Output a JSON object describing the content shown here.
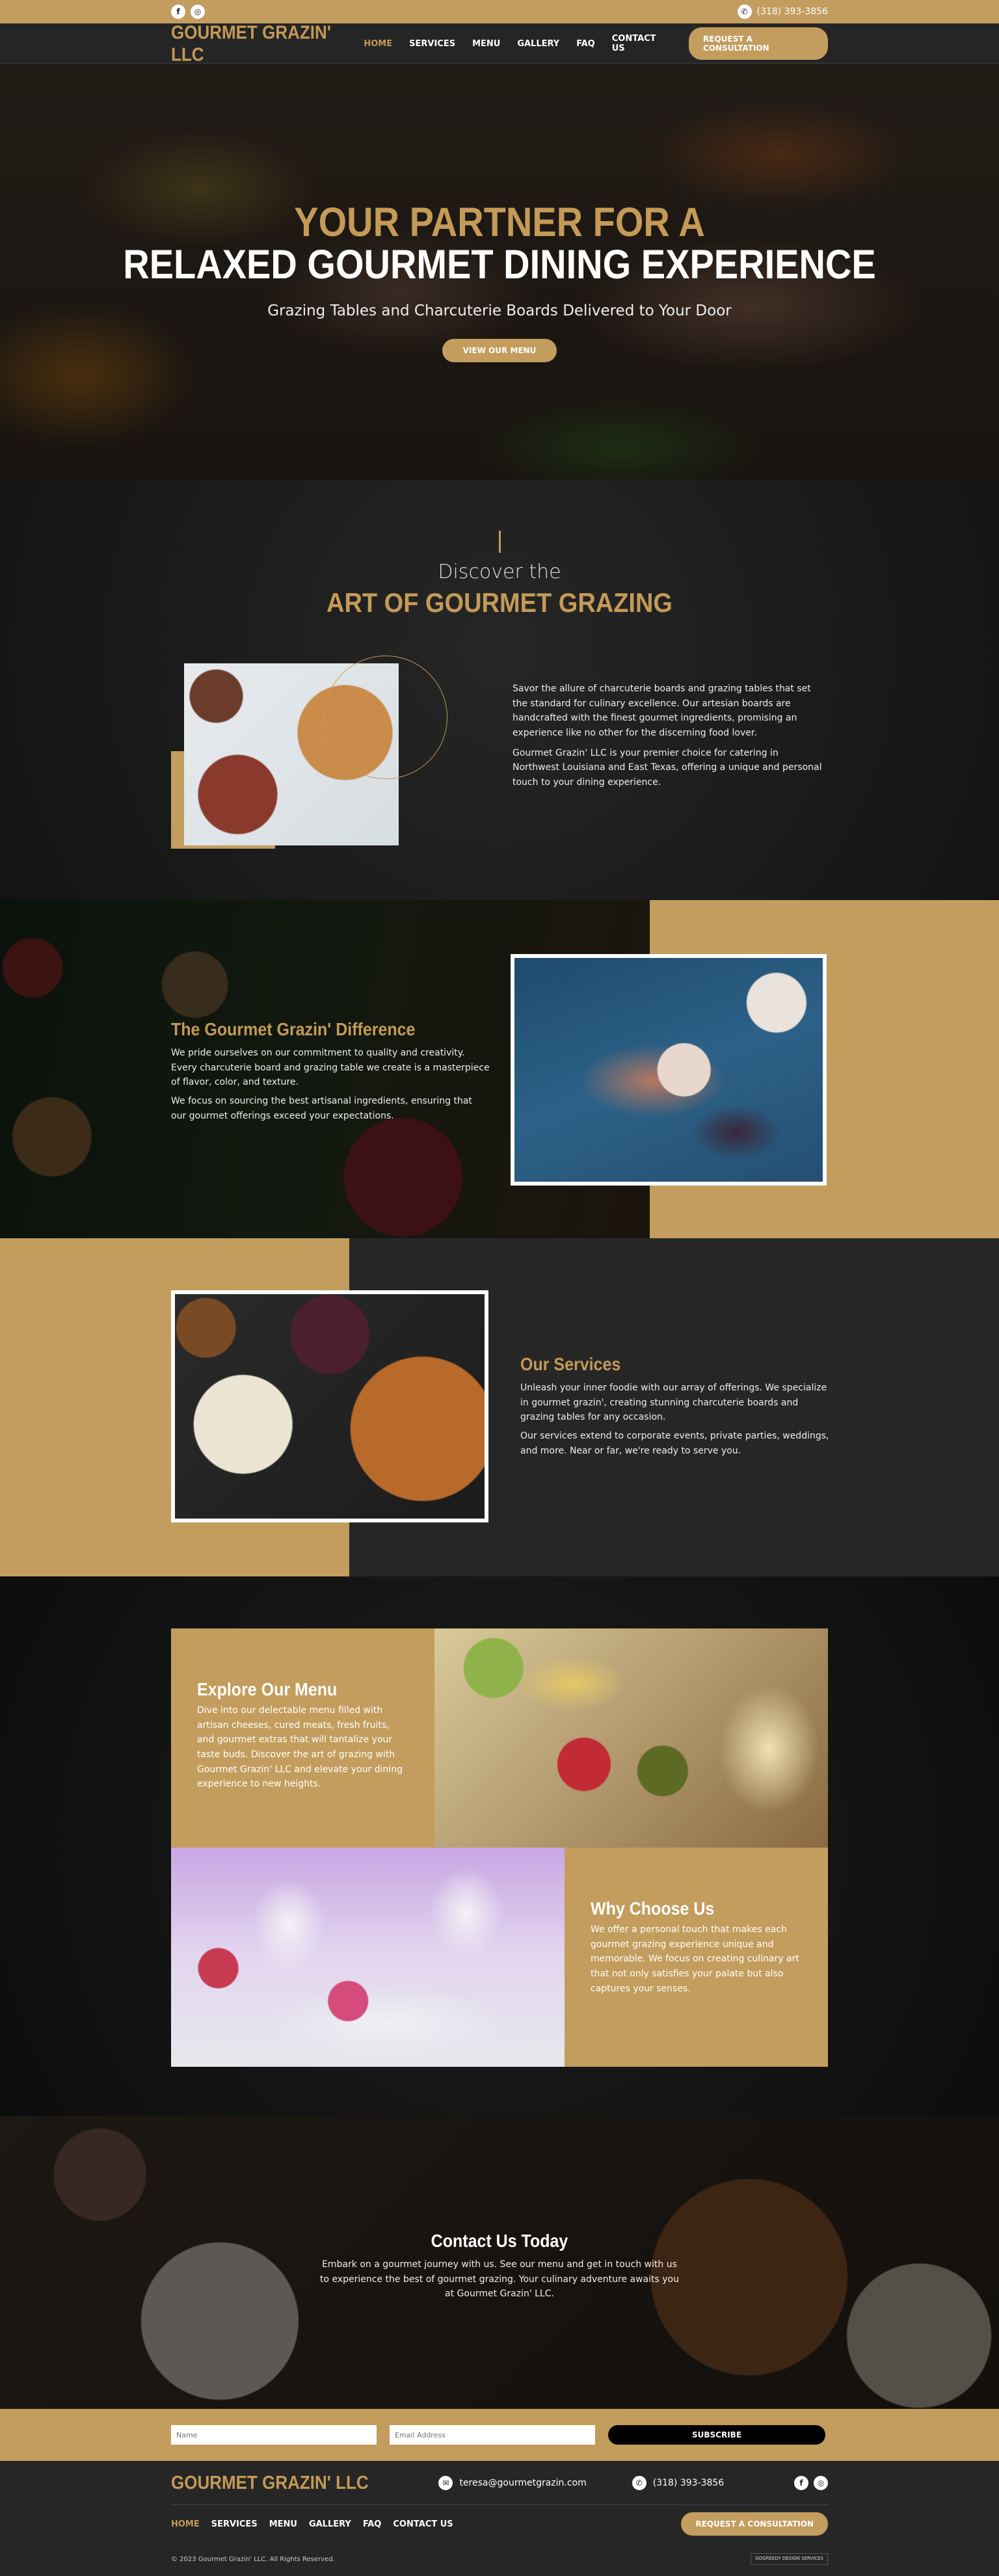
{
  "topbar": {
    "phone": "(318) 393-3856",
    "social_icons": [
      "facebook-icon",
      "instagram-icon"
    ]
  },
  "header": {
    "logo": "GOURMET GRAZIN' LLC",
    "nav": [
      "HOME",
      "SERVICES",
      "MENU",
      "GALLERY",
      "FAQ",
      "CONTACT US"
    ],
    "active_nav": "HOME",
    "cta": "REQUEST A CONSULTATION"
  },
  "hero": {
    "line1": "YOUR PARTNER FOR A",
    "line2": "RELAXED GOURMET DINING EXPERIENCE",
    "subtitle": "Grazing Tables and Charcuterie Boards Delivered to Your Door",
    "button": "VIEW OUR MENU"
  },
  "discover": {
    "kicker": "Discover the",
    "title": "ART OF GOURMET GRAZING",
    "p1": "Savor the allure of charcuterie boards and grazing tables that set the standard for culinary excellence. Our artesian boards are handcrafted with the finest gourmet ingredients, promising an experience like no other for the discerning food lover.",
    "p2": "Gourmet Grazin' LLC is your premier choice for catering in Northwest Louisiana and East Texas, offering a unique and personal touch to your dining experience."
  },
  "difference": {
    "title": "The Gourmet Grazin' Difference",
    "p1": "We pride ourselves on our commitment to quality and creativity. Every charcuterie board and grazing table we create is a masterpiece of flavor, color, and texture.",
    "p2": "We focus on sourcing the best artisanal ingredients, ensuring that our gourmet offerings exceed your expectations."
  },
  "services": {
    "title": "Our Services",
    "p1": "Unleash your inner foodie with our array of offerings. We specialize in gourmet grazin', creating stunning charcuterie boards and grazing tables for any occasion.",
    "p2": "Our services extend to corporate events, private parties, weddings, and more. Near or far, we're ready to serve you."
  },
  "explore": {
    "title": "Explore Our Menu",
    "text": "Dive into our delectable menu filled with artisan cheeses, cured meats, fresh fruits, and gourmet extras that will tantalize your taste buds. Discover the art of grazing with Gourmet Grazin' LLC and elevate your dining experience to new heights."
  },
  "why": {
    "title": "Why Choose Us",
    "text": "We offer a personal touch that makes each gourmet grazing experience unique and memorable. We focus on creating culinary art that not only satisfies your palate but also captures your senses."
  },
  "contact": {
    "title": "Contact Us Today",
    "text": "Embark on a gourmet journey with us. See our menu and get in touch with us to experience the best of gourmet grazing. Your culinary adventure awaits you at Gourmet Grazin' LLC."
  },
  "subscribe": {
    "name_placeholder": "Name",
    "email_placeholder": "Email Address",
    "button": "SUBSCRIBE"
  },
  "footer": {
    "logo": "GOURMET GRAZIN' LLC",
    "email": "teresa@gourmetgrazin.com",
    "phone": "(318) 393-3856",
    "nav": [
      "HOME",
      "SERVICES",
      "MENU",
      "GALLERY",
      "FAQ",
      "CONTACT US"
    ],
    "cta": "REQUEST A CONSULTATION",
    "copyright": "© 2023 Gourmet Grazin' LLC. All Rights Reserved.",
    "badge": "GOGREEDY DESIGN SERVICES"
  },
  "colors": {
    "gold": "#c39d5d",
    "dark": "#262626"
  }
}
